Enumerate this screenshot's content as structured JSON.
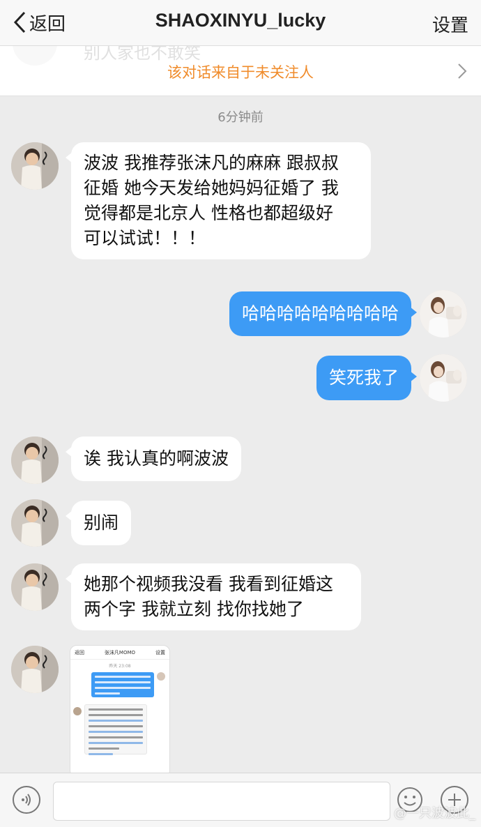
{
  "nav": {
    "back_label": "返回",
    "title": "SHAOXINYU_lucky",
    "settings_label": "设置"
  },
  "notice": {
    "ghost_text": "别人家也不敢笑",
    "text": "该对话来自于未关注人"
  },
  "chat": {
    "timestamp": "6分钟前",
    "messages": [
      {
        "side": "in",
        "lines": [
          "波波 我推荐张沫凡的麻麻 跟叔叔",
          "征婚  她今天发给她妈妈征婚了 我",
          "觉得都是北京人 性格也都超级好",
          "可以试试！！！"
        ]
      },
      {
        "side": "out",
        "lines": [
          "哈哈哈哈哈哈哈哈哈"
        ]
      },
      {
        "side": "out",
        "lines": [
          "笑死我了"
        ]
      },
      {
        "side": "in",
        "lines": [
          "诶 我认真的啊波波"
        ]
      },
      {
        "side": "in",
        "lines": [
          "别闹"
        ]
      },
      {
        "side": "in",
        "lines": [
          "她那个视频我没看 我看到征婚这",
          "两个字 我就立刻 找你找她了"
        ]
      }
    ],
    "image_message": {
      "back": "返回",
      "title": "张沫凡MOMO",
      "settings": "设置",
      "time": "昨天 23:08"
    }
  },
  "input": {
    "placeholder": ""
  },
  "watermark": "@一只波波此_",
  "icons": {
    "back": "chevron-left-icon",
    "notice_arrow": "chevron-right-icon",
    "voice": "voice-icon",
    "emoji": "emoji-icon",
    "plus": "plus-icon"
  },
  "colors": {
    "outgoing_bubble": "#3d9bf5",
    "notice_text": "#f08b2a",
    "chat_background": "#ececec"
  }
}
